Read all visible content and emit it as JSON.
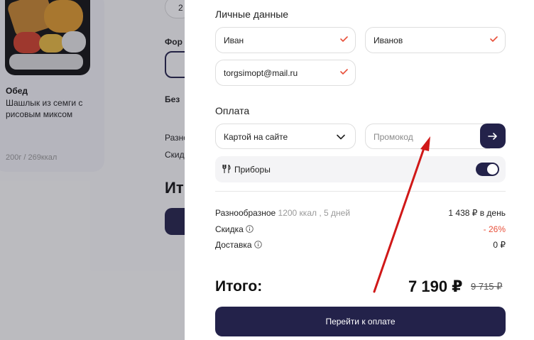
{
  "background": {
    "product": {
      "name": "Обед",
      "description": "Шашлык из семги с рисовым миксом",
      "meta": "200г / 269ккал"
    },
    "fragments": {
      "pill_text": "2",
      "format_label": "Фор",
      "without_label": "Без",
      "variety_label": "Разно",
      "discount_label": "Скид",
      "total_label": "Ит"
    }
  },
  "drawer": {
    "personal_title": "Личные данные",
    "first_name": "Иван",
    "last_name": "Иванов",
    "email": "torgsimopt@mail.ru",
    "payment_title": "Оплата",
    "payment_method": "Картой на сайте",
    "promo_placeholder": "Промокод",
    "cutlery_label": "Приборы",
    "cutlery_enabled": true,
    "summary": {
      "plan_name": "Разнообразное",
      "plan_details": "1200 ккал , 5 дней",
      "plan_price": "1 438 ₽ в день",
      "discount_label": "Скидка",
      "discount_value": "- 26%",
      "delivery_label": "Доставка",
      "delivery_value": "0 ₽"
    },
    "total_label": "Итого:",
    "total_price": "7 190 ₽",
    "old_price": "9 715 ₽",
    "pay_button": "Перейти к оплате"
  },
  "colors": {
    "primary": "#23224a",
    "check": "#e8503a",
    "discount": "#e8503a",
    "annotation_arrow": "#d01818"
  },
  "icons": [
    "check-icon",
    "chevron-down-icon",
    "arrow-right-icon",
    "cutlery-icon",
    "info-icon"
  ]
}
